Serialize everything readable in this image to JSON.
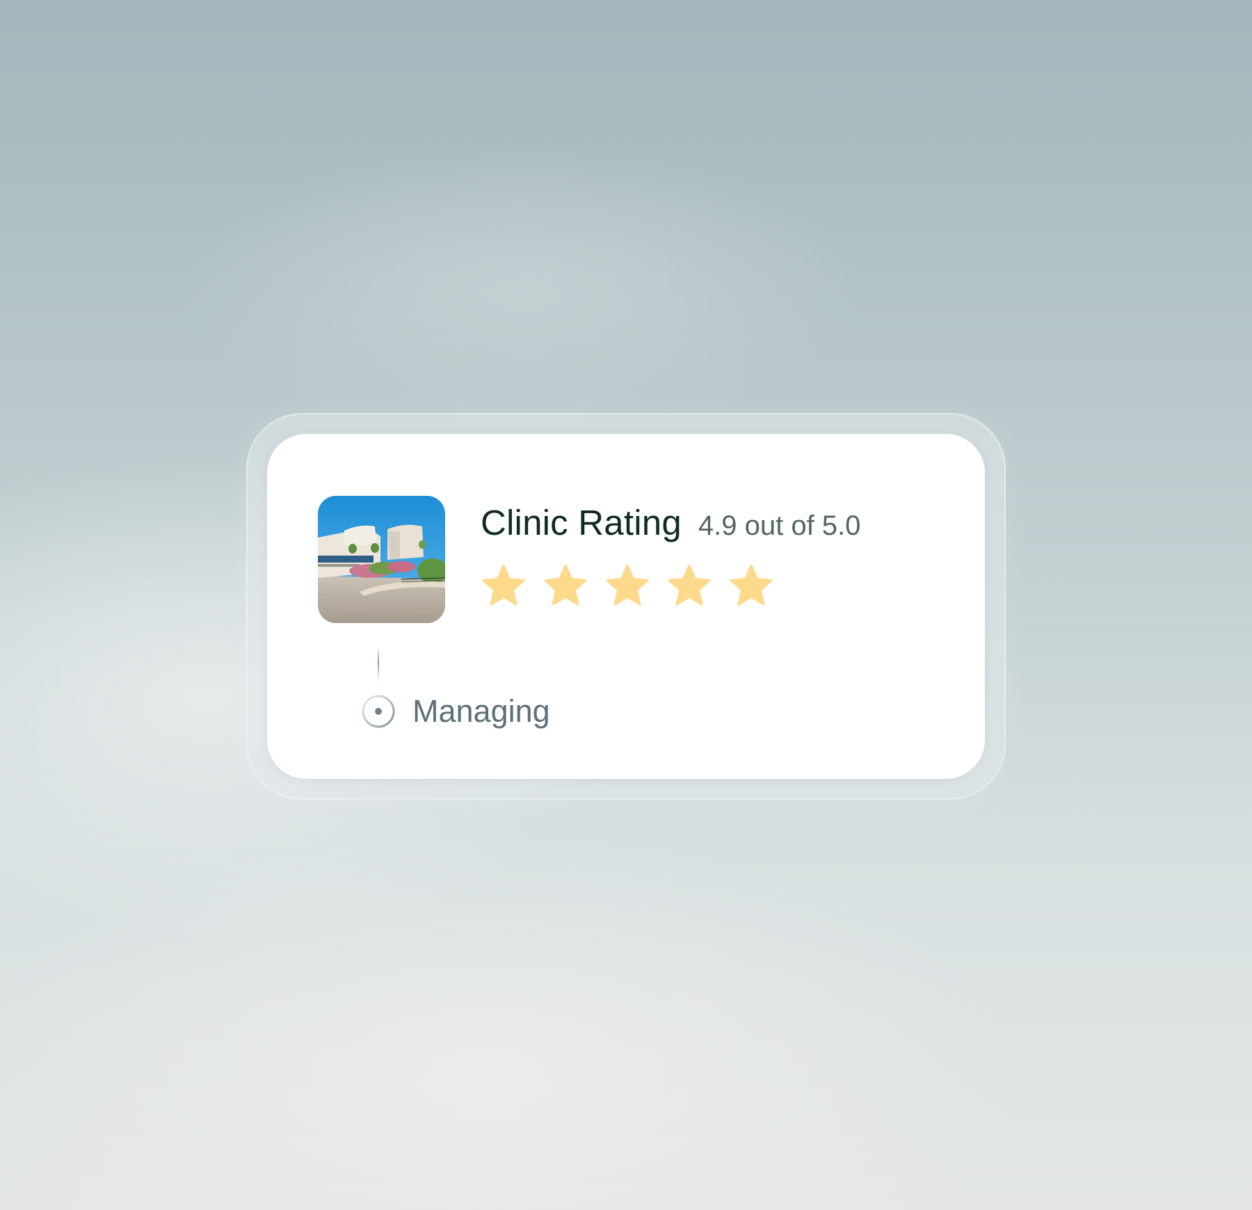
{
  "card": {
    "title": "Clinic Rating",
    "rating_text": "4.9 out of 5.0",
    "rating_value": 4.9,
    "rating_max": 5,
    "stars_filled": 5,
    "star_color": "#fdd98c",
    "status_label": "Managing",
    "image_icon": "clinic-building-photo",
    "status_icon": "radio-dot-icon"
  }
}
